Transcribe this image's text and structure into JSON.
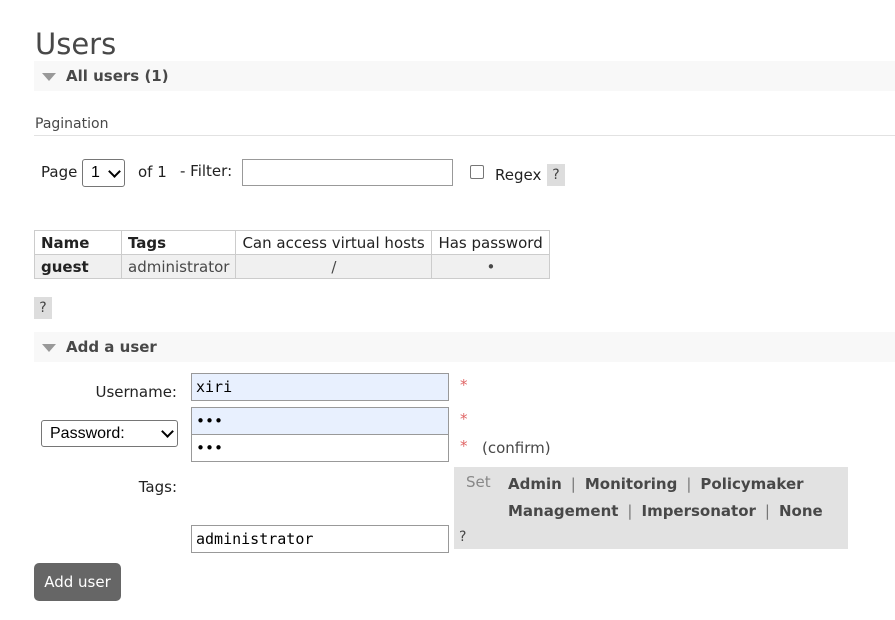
{
  "page_title": "Users",
  "all_users_section": {
    "label": "All users (1)"
  },
  "pagination": {
    "heading": "Pagination",
    "page_label": "Page",
    "page_value": "1",
    "of_label": "of 1",
    "filter_label": "- Filter:",
    "filter_value": "",
    "regex_label": "Regex",
    "regex_checked": false,
    "help": "?"
  },
  "users_table": {
    "columns": [
      "Name",
      "Tags",
      "Can access virtual hosts",
      "Has password"
    ],
    "rows": [
      {
        "name": "guest",
        "tags": "administrator",
        "vhosts": "/",
        "has_password": "•"
      }
    ],
    "help": "?"
  },
  "add_user_section": {
    "label": "Add a user",
    "username_label": "Username:",
    "username_value": "xiri",
    "password_select_value": "Password:",
    "password_value": "•••",
    "password_confirm_value": "•••",
    "confirm_label": "(confirm)",
    "required_mark": "*",
    "tags_label": "Tags:",
    "set_label": "Set",
    "tag_options": [
      "Admin",
      "Monitoring",
      "Policymaker",
      "Management",
      "Impersonator",
      "None"
    ],
    "separator": "|",
    "tags_value": "administrator",
    "tags_help": "?",
    "submit_label": "Add user"
  }
}
